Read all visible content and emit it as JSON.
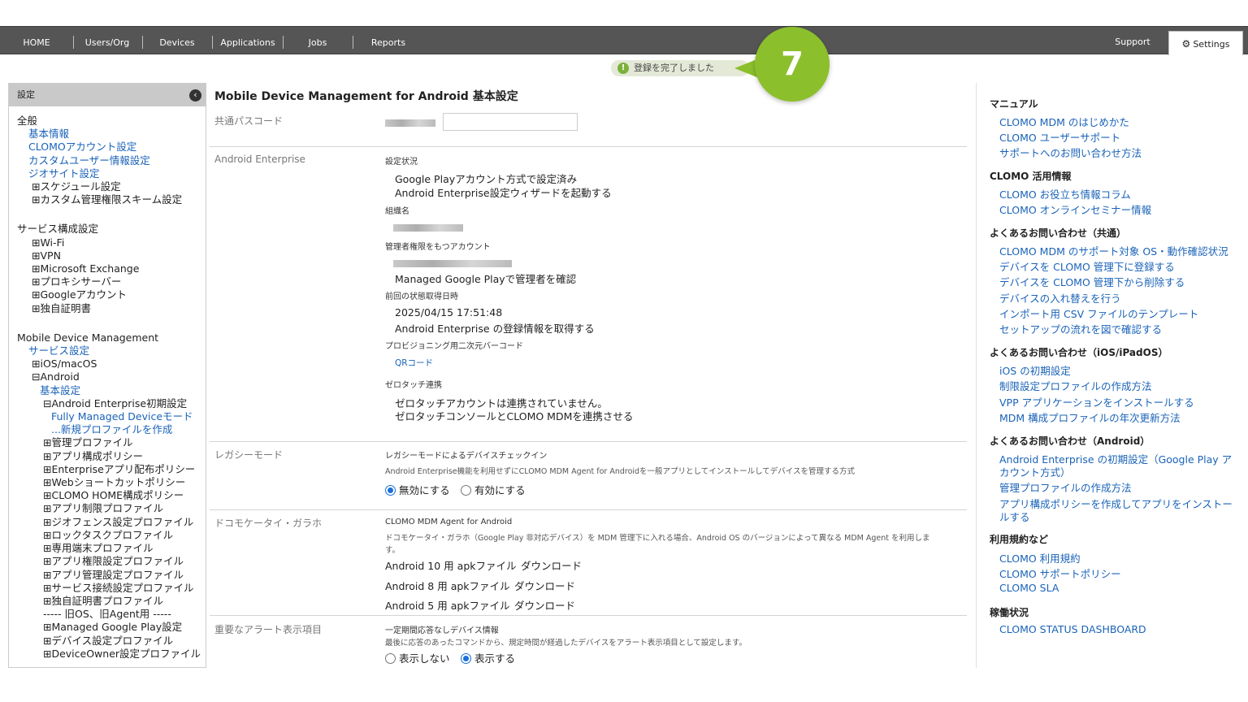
{
  "nav": {
    "items": [
      "HOME",
      "Users/Org",
      "Devices",
      "Applications",
      "Jobs",
      "Reports"
    ],
    "support": "Support",
    "settings": "Settings"
  },
  "notice": {
    "text": "登録を完了しました",
    "step": "7"
  },
  "sidebar": {
    "title": "設定",
    "tree": [
      {
        "t": "全般",
        "k": "cat",
        "i": 0
      },
      {
        "t": "基本情報",
        "k": "link",
        "i": 1
      },
      {
        "t": "CLOMOアカウント設定",
        "k": "link",
        "i": 1
      },
      {
        "t": "カスタムユーザー情報設定",
        "k": "link",
        "i": 1
      },
      {
        "t": "ジオサイト設定",
        "k": "link",
        "i": 1
      },
      {
        "t": "⊞スケジュール設定",
        "k": "exp",
        "i": 2
      },
      {
        "t": "⊞カスタム管理権限スキーム設定",
        "k": "exp",
        "i": 2
      },
      {
        "t": "",
        "k": "gap",
        "i": 0
      },
      {
        "t": "サービス構成設定",
        "k": "cat",
        "i": 0
      },
      {
        "t": "⊞Wi-Fi",
        "k": "exp",
        "i": 2
      },
      {
        "t": "⊞VPN",
        "k": "exp",
        "i": 2
      },
      {
        "t": "⊞Microsoft Exchange",
        "k": "exp",
        "i": 2
      },
      {
        "t": "⊞プロキシサーバー",
        "k": "exp",
        "i": 2
      },
      {
        "t": "⊞Googleアカウント",
        "k": "exp",
        "i": 2
      },
      {
        "t": "⊞独自証明書",
        "k": "exp",
        "i": 2
      },
      {
        "t": "",
        "k": "gap",
        "i": 0
      },
      {
        "t": "Mobile Device Management",
        "k": "cat",
        "i": 0
      },
      {
        "t": "サービス設定",
        "k": "link",
        "i": 1
      },
      {
        "t": "⊞iOS/macOS",
        "k": "exp",
        "i": 2
      },
      {
        "t": "⊟Android",
        "k": "exp",
        "i": 2
      },
      {
        "t": "基本設定",
        "k": "link",
        "i": 3
      },
      {
        "t": "⊟Android Enterprise初期設定",
        "k": "exp",
        "i": 4
      },
      {
        "t": "Fully Managed Deviceモード",
        "k": "link",
        "i": 5
      },
      {
        "t": "...新規プロファイルを作成",
        "k": "link",
        "i": 5
      },
      {
        "t": "⊞管理プロファイル",
        "k": "exp",
        "i": 4
      },
      {
        "t": "⊞アプリ構成ポリシー",
        "k": "exp",
        "i": 4
      },
      {
        "t": "⊞Enterpriseアプリ配布ポリシー",
        "k": "exp",
        "i": 4
      },
      {
        "t": "⊞Webショートカットポリシー",
        "k": "exp",
        "i": 4
      },
      {
        "t": "⊞CLOMO HOME構成ポリシー",
        "k": "exp",
        "i": 4
      },
      {
        "t": "⊞アプリ制限プロファイル",
        "k": "exp",
        "i": 4
      },
      {
        "t": "⊞ジオフェンス設定プロファイル",
        "k": "exp",
        "i": 4
      },
      {
        "t": "⊞ロックタスクプロファイル",
        "k": "exp",
        "i": 4
      },
      {
        "t": "⊞専用端末プロファイル",
        "k": "exp",
        "i": 4
      },
      {
        "t": "⊞アプリ権限設定プロファイル",
        "k": "exp",
        "i": 4
      },
      {
        "t": "⊞アプリ管理設定プロファイル",
        "k": "exp",
        "i": 4
      },
      {
        "t": "⊞サービス接続設定プロファイル",
        "k": "exp",
        "i": 4
      },
      {
        "t": "⊞独自証明書プロファイル",
        "k": "exp",
        "i": 4
      },
      {
        "t": "----- 旧OS、旧Agent用 -----",
        "k": "exp",
        "i": 4
      },
      {
        "t": "⊞Managed Google Play設定",
        "k": "exp",
        "i": 4
      },
      {
        "t": "⊞デバイス設定プロファイル",
        "k": "exp",
        "i": 4
      },
      {
        "t": "⊞DeviceOwner設定プロファイル",
        "k": "exp",
        "i": 4
      }
    ]
  },
  "main": {
    "title": "Mobile Device Management for Android 基本設定",
    "passcode_label": "共通パスコード",
    "ae": {
      "label": "Android Enterprise",
      "status_head": "設定状況",
      "status_text": "Google Playアカウント方式で設定済み",
      "status_link": "Android Enterprise設定ウィザードを起動する",
      "org_head": "組織名",
      "admin_head": "管理者権限をもつアカウント",
      "admin_link": "Managed Google Playで管理者を確認",
      "last_head": "前回の状態取得日時",
      "last_value": "2025/04/15 17:51:48",
      "last_link": "Android Enterprise の登録情報を取得する",
      "qr_head": "プロビジョニング用二次元バーコード",
      "qr_link": "QRコード",
      "zt_head": "ゼロタッチ連携",
      "zt_text": "ゼロタッチアカウントは連携されていません。",
      "zt_link": "ゼロタッチコンソールとCLOMO MDMを連携させる"
    },
    "legacy": {
      "label": "レガシーモード",
      "head": "レガシーモードによるデバイスチェックイン",
      "desc": "Android Enterprise機能を利用せずにCLOMO MDM Agent for Androidを一般アプリとしてインストールしてデバイスを管理する方式",
      "opt_off": "無効にする",
      "opt_on": "有効にする"
    },
    "docomo": {
      "label": "ドコモケータイ・ガラホ",
      "head": "CLOMO MDM Agent for Android",
      "desc": "ドコモケータイ・ガラホ（Google Play 非対応デバイス）を MDM 管理下に入れる場合、Android OS のバージョンによって異なる MDM Agent を利用しま",
      "desc2": "す。",
      "apk10": "Android 10 用 apkファイル",
      "apk8": "Android 8 用 apkファイル",
      "apk5": "Android 5 用 apkファイル",
      "download": "ダウンロード"
    },
    "alert": {
      "label": "重要なアラート表示項目",
      "head": "一定期間応答なしデバイス情報",
      "desc": "最後に応答のあったコマンドから、規定時間が経過したデバイスをアラート表示項目として設定します。",
      "opt_hide": "表示しない",
      "opt_show": "表示する"
    }
  },
  "right": {
    "sections": [
      {
        "head": "マニュアル",
        "links": [
          "CLOMO MDM のはじめかた",
          "CLOMO ユーザーサポート",
          "サポートへのお問い合わせ方法"
        ]
      },
      {
        "head": "CLOMO 活用情報",
        "links": [
          "CLOMO お役立ち情報コラム",
          "CLOMO オンラインセミナー情報"
        ]
      },
      {
        "head": "よくあるお問い合わせ（共通）",
        "links": [
          "CLOMO MDM のサポート対象 OS・動作確認状況",
          "デバイスを CLOMO 管理下に登録する",
          "デバイスを CLOMO 管理下から削除する",
          "デバイスの入れ替えを行う",
          "インポート用 CSV ファイルのテンプレート",
          "セットアップの流れを図で確認する"
        ]
      },
      {
        "head": "よくあるお問い合わせ（iOS/iPadOS）",
        "links": [
          "iOS の初期設定",
          "制限設定プロファイルの作成方法",
          "VPP アプリケーションをインストールする",
          "MDM 構成プロファイルの年次更新方法"
        ]
      },
      {
        "head": "よくあるお問い合わせ（Android）",
        "links": [
          "Android Enterprise の初期設定（Google Play ア",
          "カウント方式）",
          "管理プロファイルの作成方法",
          "アプリ構成ポリシーを作成してアプリをインストー",
          "ルする"
        ]
      },
      {
        "head": "利用規約など",
        "links": [
          "CLOMO 利用規約",
          "CLOMO サポートポリシー",
          "CLOMO SLA"
        ]
      },
      {
        "head": "稼働状況",
        "links": [
          "CLOMO STATUS DASHBOARD"
        ]
      }
    ]
  }
}
